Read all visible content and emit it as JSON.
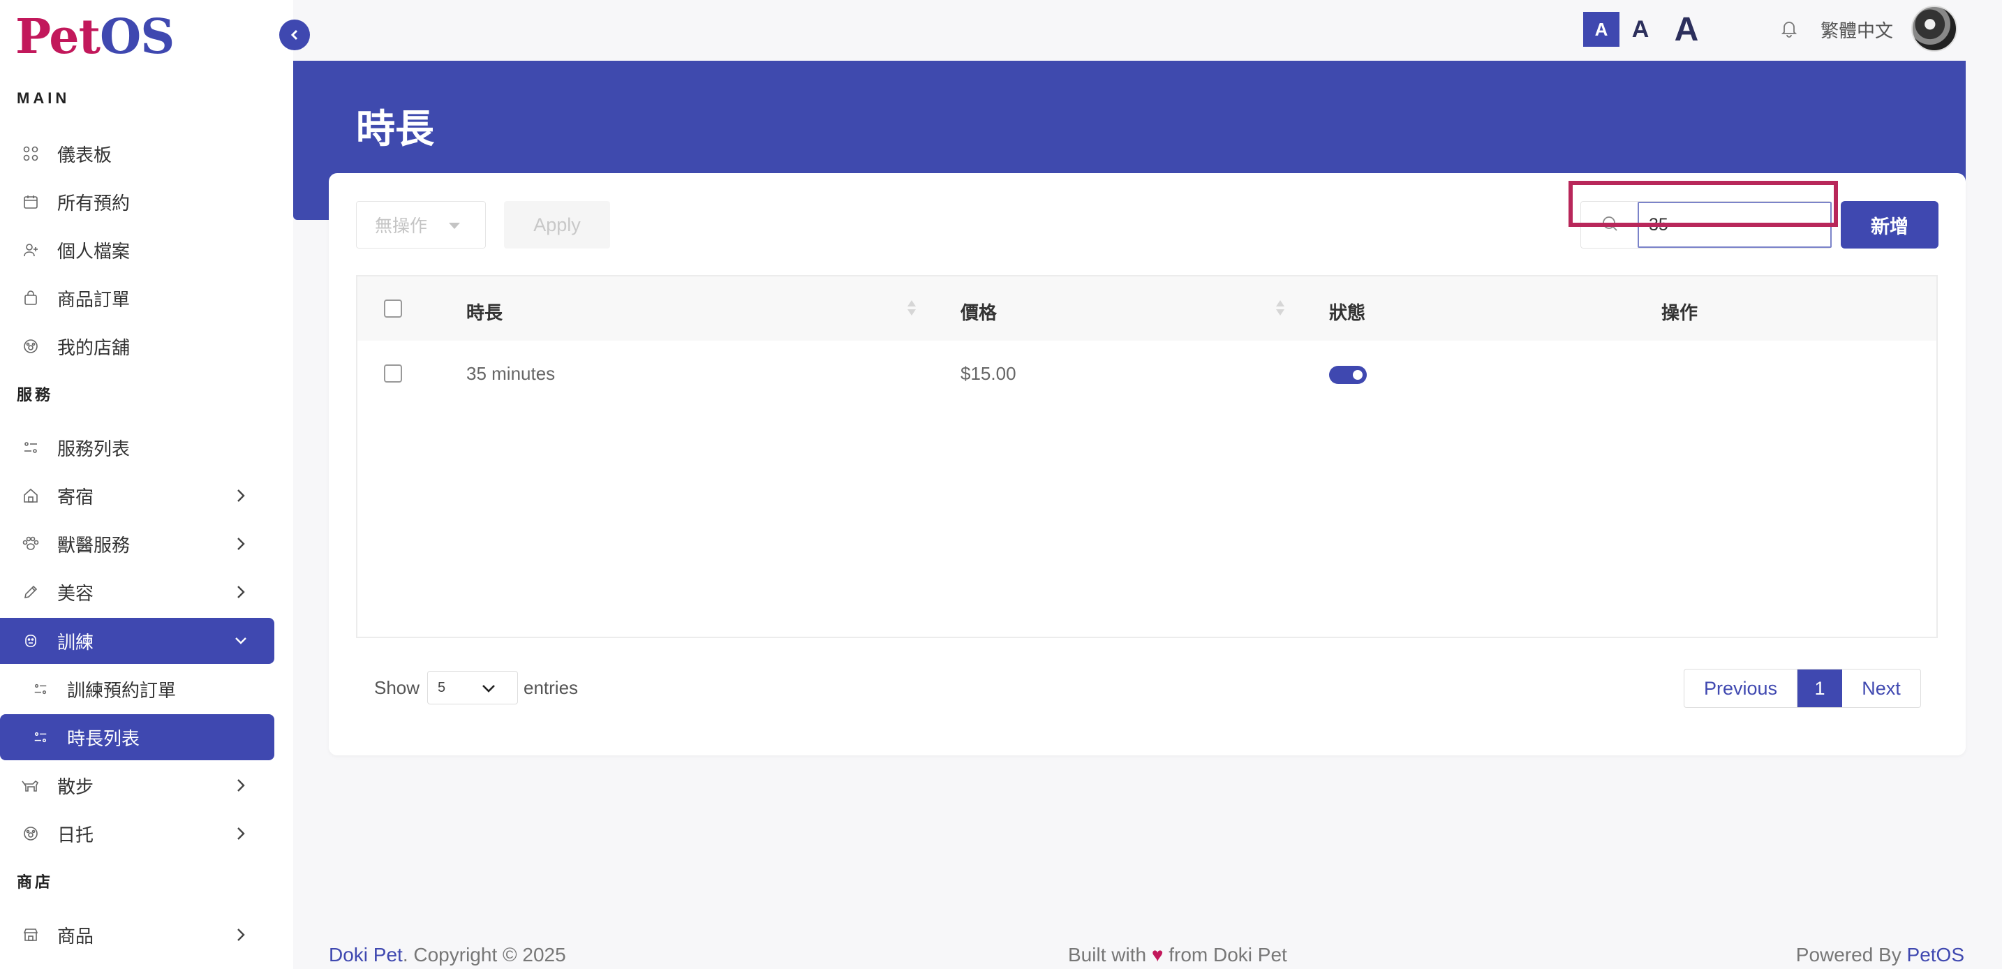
{
  "brand": {
    "logo_pet": "Pet",
    "logo_os": "OS"
  },
  "sidebar": {
    "section_main": "MAIN",
    "section_services": "服務",
    "section_shop": "商店",
    "items": [
      {
        "label": "儀表板",
        "icon": "grid-icon"
      },
      {
        "label": "所有預約",
        "icon": "calendar-icon"
      },
      {
        "label": "個人檔案",
        "icon": "user-plus-icon"
      },
      {
        "label": "商品訂單",
        "icon": "shopping-bag-icon"
      },
      {
        "label": "我的店舖",
        "icon": "paw-shop-icon"
      },
      {
        "label": "服務列表",
        "icon": "list-settings-icon"
      },
      {
        "label": "寄宿",
        "icon": "home-icon"
      },
      {
        "label": "獸醫服務",
        "icon": "paw-icon"
      },
      {
        "label": "美容",
        "icon": "brush-icon"
      },
      {
        "label": "訓練",
        "icon": "dog-face-icon"
      },
      {
        "label": "訓練預約訂單",
        "icon": "list-settings-icon"
      },
      {
        "label": "時長列表",
        "icon": "list-settings-icon"
      },
      {
        "label": "散步",
        "icon": "dog-walk-icon"
      },
      {
        "label": "日托",
        "icon": "paw-shop-icon"
      },
      {
        "label": "商品",
        "icon": "store-icon"
      }
    ]
  },
  "topbar": {
    "font_small": "A",
    "font_medium": "A",
    "font_large": "A",
    "language": "繁體中文"
  },
  "page": {
    "title": "時長"
  },
  "toolbar": {
    "bulk_action": "無操作",
    "apply_label": "Apply",
    "search_value": "35",
    "add_label": "新增"
  },
  "table": {
    "columns": [
      "時長",
      "價格",
      "狀態",
      "操作"
    ],
    "rows": [
      {
        "duration": "35 minutes",
        "price": "$15.00",
        "status_on": true
      }
    ]
  },
  "pagination": {
    "show_label": "Show",
    "entries_value": "5",
    "entries_label": "entries",
    "previous": "Previous",
    "current": "1",
    "next": "Next"
  },
  "footer": {
    "brand": "Doki Pet",
    "copyright": ". Copyright © 2025",
    "built_prefix": "Built with ",
    "heart": "♥",
    "built_suffix": " from Doki Pet",
    "powered_prefix": "Powered By ",
    "powered_brand": "PetOS"
  },
  "colors": {
    "primary": "#3f48b0",
    "accent": "#c2185b",
    "highlight": "#b8275a"
  }
}
